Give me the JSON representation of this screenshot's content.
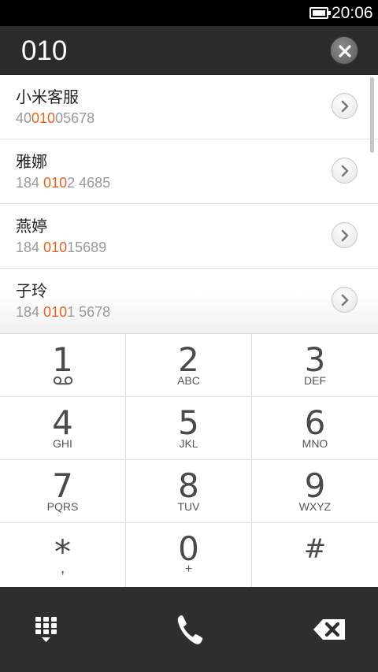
{
  "status_bar": {
    "time": "20:06"
  },
  "dial_input": {
    "value": "010"
  },
  "contacts": [
    {
      "name": "小米客服",
      "number_prefix": "40",
      "number_match": "010",
      "number_suffix": "05678"
    },
    {
      "name": "雅娜",
      "number_prefix": "184 ",
      "number_match": "010",
      "number_suffix": "2 4685"
    },
    {
      "name": "燕婷",
      "number_prefix": "184 ",
      "number_match": "010",
      "number_suffix": "15689"
    },
    {
      "name": "子玲",
      "number_prefix": "184 ",
      "number_match": "010",
      "number_suffix": "1 5678"
    }
  ],
  "keypad": {
    "keys": [
      {
        "digit": "1",
        "letters": ""
      },
      {
        "digit": "2",
        "letters": "ABC"
      },
      {
        "digit": "3",
        "letters": "DEF"
      },
      {
        "digit": "4",
        "letters": "GHI"
      },
      {
        "digit": "5",
        "letters": "JKL"
      },
      {
        "digit": "6",
        "letters": "MNO"
      },
      {
        "digit": "7",
        "letters": "PQRS"
      },
      {
        "digit": "8",
        "letters": "TUV"
      },
      {
        "digit": "9",
        "letters": "WXYZ"
      },
      {
        "digit": "*",
        "letters": ","
      },
      {
        "digit": "0",
        "letters": "+"
      },
      {
        "digit": "#",
        "letters": ""
      }
    ]
  },
  "icons": {
    "voicemail": "voicemail-icon",
    "clear": "clear-icon",
    "chevron": "chevron-right-icon",
    "dialpad_toggle": "dialpad-icon",
    "call": "phone-icon",
    "backspace": "backspace-icon"
  },
  "colors": {
    "match_highlight": "#e8621a",
    "top_bar": "#2b2b2b",
    "bottom_bar": "#2e2e2e"
  }
}
